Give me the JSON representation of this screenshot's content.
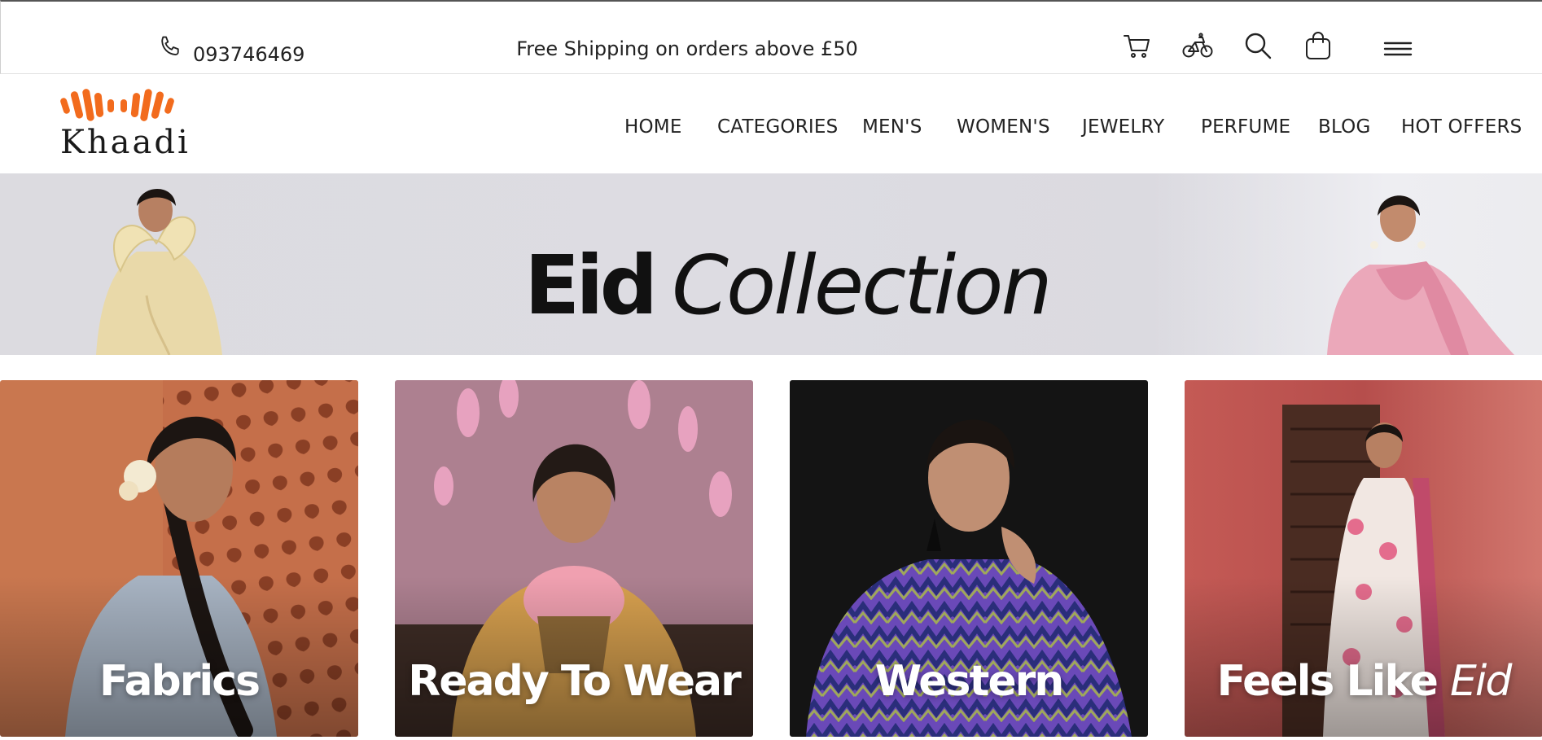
{
  "topbar": {
    "phone_number": "093746469",
    "shipping_text": "Free Shipping on orders above £50",
    "icons": [
      "phone-icon",
      "cart-icon",
      "bicycle-icon",
      "search-icon",
      "shopping-bag-icon",
      "hamburger-menu-icon"
    ]
  },
  "brand": {
    "name": "Khaadi",
    "accent": "#f26b1d"
  },
  "nav": {
    "items": [
      "HOME",
      "CATEGORIES",
      "MEN'S",
      "WOMEN'S",
      "JEWELRY",
      "PERFUME",
      "BLOG",
      "HOT OFFERS"
    ]
  },
  "banner": {
    "title_bold": "Eid",
    "title_light": "Collection"
  },
  "tiles": [
    {
      "label": "Fabrics"
    },
    {
      "label": "Ready To Wear"
    },
    {
      "label": "Western"
    },
    {
      "label_main": "Feels Like",
      "label_em": "Eid"
    }
  ],
  "colors": {
    "banner_bg": "#dcdbe0",
    "tile_fabrics": "#c8734f",
    "tile_rtw": "#a57683",
    "tile_western": "#151515",
    "tile_eid": "#b5524e"
  }
}
